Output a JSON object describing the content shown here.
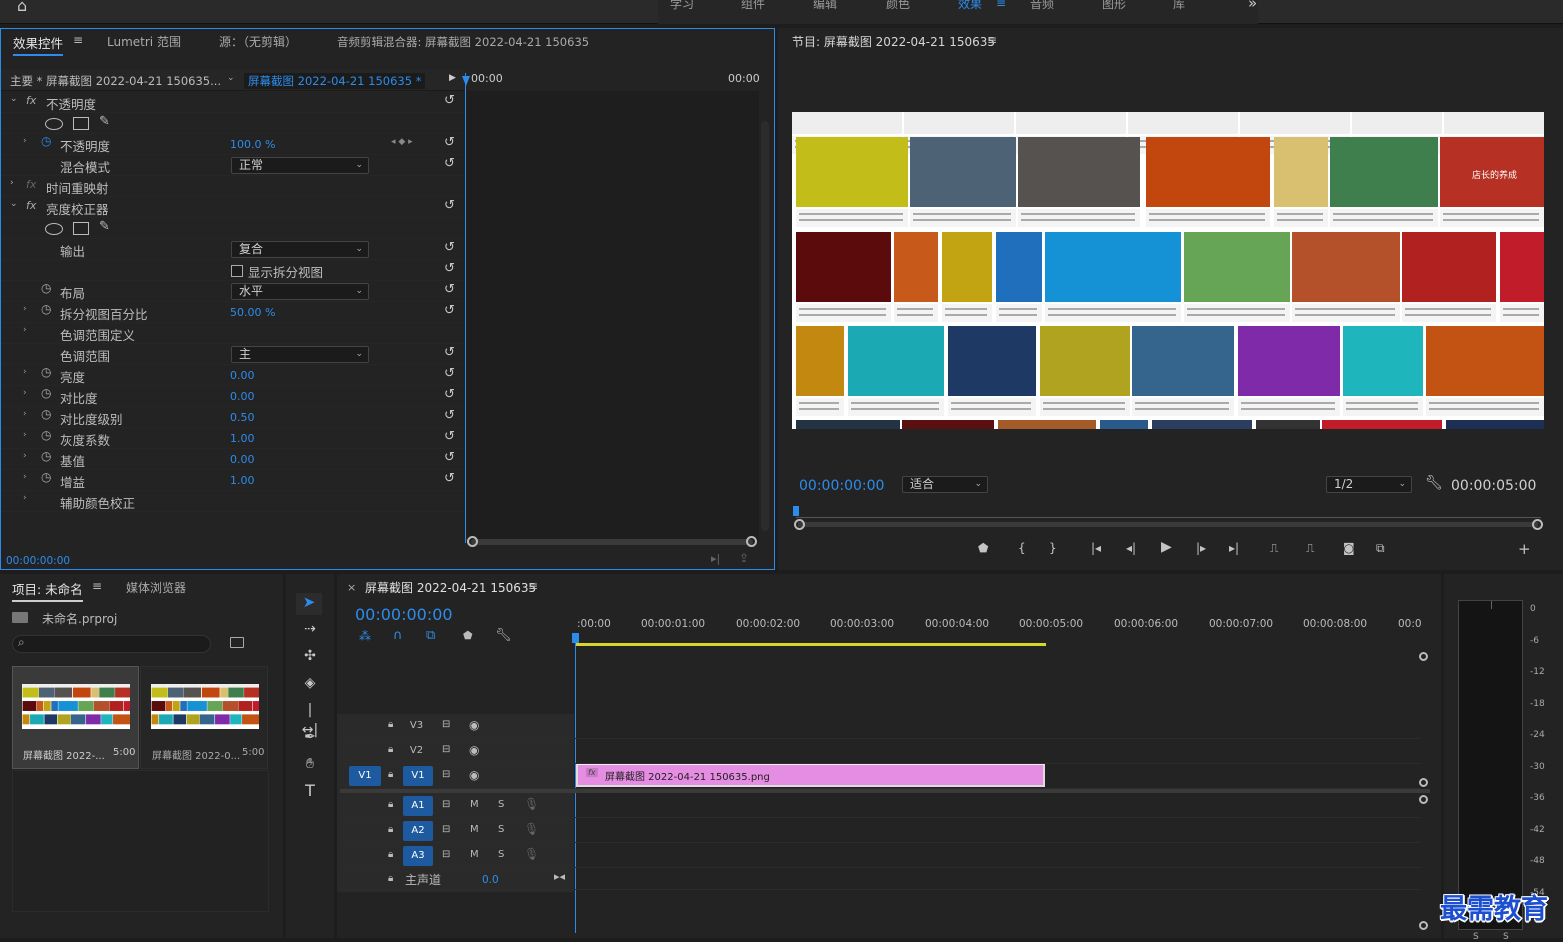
{
  "workspaces": {
    "items": [
      "学习",
      "组件",
      "编辑",
      "颜色",
      "效果",
      "音频",
      "图形",
      "库"
    ],
    "active": "效果",
    "more": "»"
  },
  "effect_controls": {
    "tabs": [
      "效果控件",
      "Lumetri 范围",
      "源：（无剪辑）",
      "音频剪辑混合器: 屏幕截图 2022-04-21 150635"
    ],
    "master": "主要 * 屏幕截图 2022-04-21 150635...",
    "clip": "屏幕截图 2022-04-21 150635 *",
    "tc_left": "00:00",
    "tc_right": "00:00",
    "fx_opacity": "不透明度",
    "rows": [
      {
        "label": "不透明度",
        "value": "100.0 %"
      },
      {
        "label": "混合模式",
        "dropdown": "正常"
      },
      {
        "label": "时间重映射"
      },
      {
        "label": "亮度校正器"
      },
      {
        "label": "输出",
        "dropdown": "复合"
      },
      {
        "label": "显示拆分视图"
      },
      {
        "label": "布局",
        "dropdown": "水平"
      },
      {
        "label": "拆分视图百分比",
        "value": "50.00 %"
      },
      {
        "label": "色调范围定义"
      },
      {
        "label": "色调范围",
        "dropdown": "主"
      },
      {
        "label": "亮度",
        "value": "0.00"
      },
      {
        "label": "对比度",
        "value": "0.00"
      },
      {
        "label": "对比度级别",
        "value": "0.50"
      },
      {
        "label": "灰度系数",
        "value": "1.00"
      },
      {
        "label": "基值",
        "value": "0.00"
      },
      {
        "label": "增益",
        "value": "1.00"
      },
      {
        "label": "辅助颜色校正"
      }
    ],
    "timecode": "00:00:00:00"
  },
  "program": {
    "title": "节目: 屏幕截图 2022-04-21 150635",
    "timecode": "00:00:00:00",
    "fit": "适合",
    "resolution": "1/2",
    "duration": "00:00:05:00",
    "thumb_overlay": "店长的养成"
  },
  "project": {
    "tabs": [
      "项目: 未命名",
      "媒体浏览器"
    ],
    "file": "未命名.prproj",
    "items": [
      {
        "name": "屏幕截图 2022-...",
        "dur": "5:00"
      },
      {
        "name": "屏幕截图 2022-0...",
        "dur": "5:00"
      }
    ]
  },
  "timeline": {
    "title": "屏幕截图 2022-04-21 150635",
    "timecode": "00:00:00:00",
    "ruler": [
      ":00:00",
      "00:00:01:00",
      "00:00:02:00",
      "00:00:03:00",
      "00:00:04:00",
      "00:00:05:00",
      "00:00:06:00",
      "00:00:07:00",
      "00:00:08:00",
      "00:0"
    ],
    "video_tracks": [
      "V3",
      "V2",
      "V1"
    ],
    "src_track": "V1",
    "audio_tracks": [
      "A1",
      "A2",
      "A3"
    ],
    "m": "M",
    "s": "S",
    "master": "主声道",
    "master_val": "0.0",
    "clip": "屏幕截图 2022-04-21 150635.png",
    "fx": "fx"
  },
  "meter": {
    "labels": [
      "0",
      "-6",
      "-12",
      "-18",
      "-24",
      "-30",
      "-36",
      "-42",
      "-48",
      "-54"
    ],
    "footer": [
      "S",
      "S"
    ]
  },
  "watermark": "最需教育",
  "colors": {
    "accent": "#2d8ceb",
    "clip": "#e58de2",
    "workarea": "#d8d42c"
  }
}
